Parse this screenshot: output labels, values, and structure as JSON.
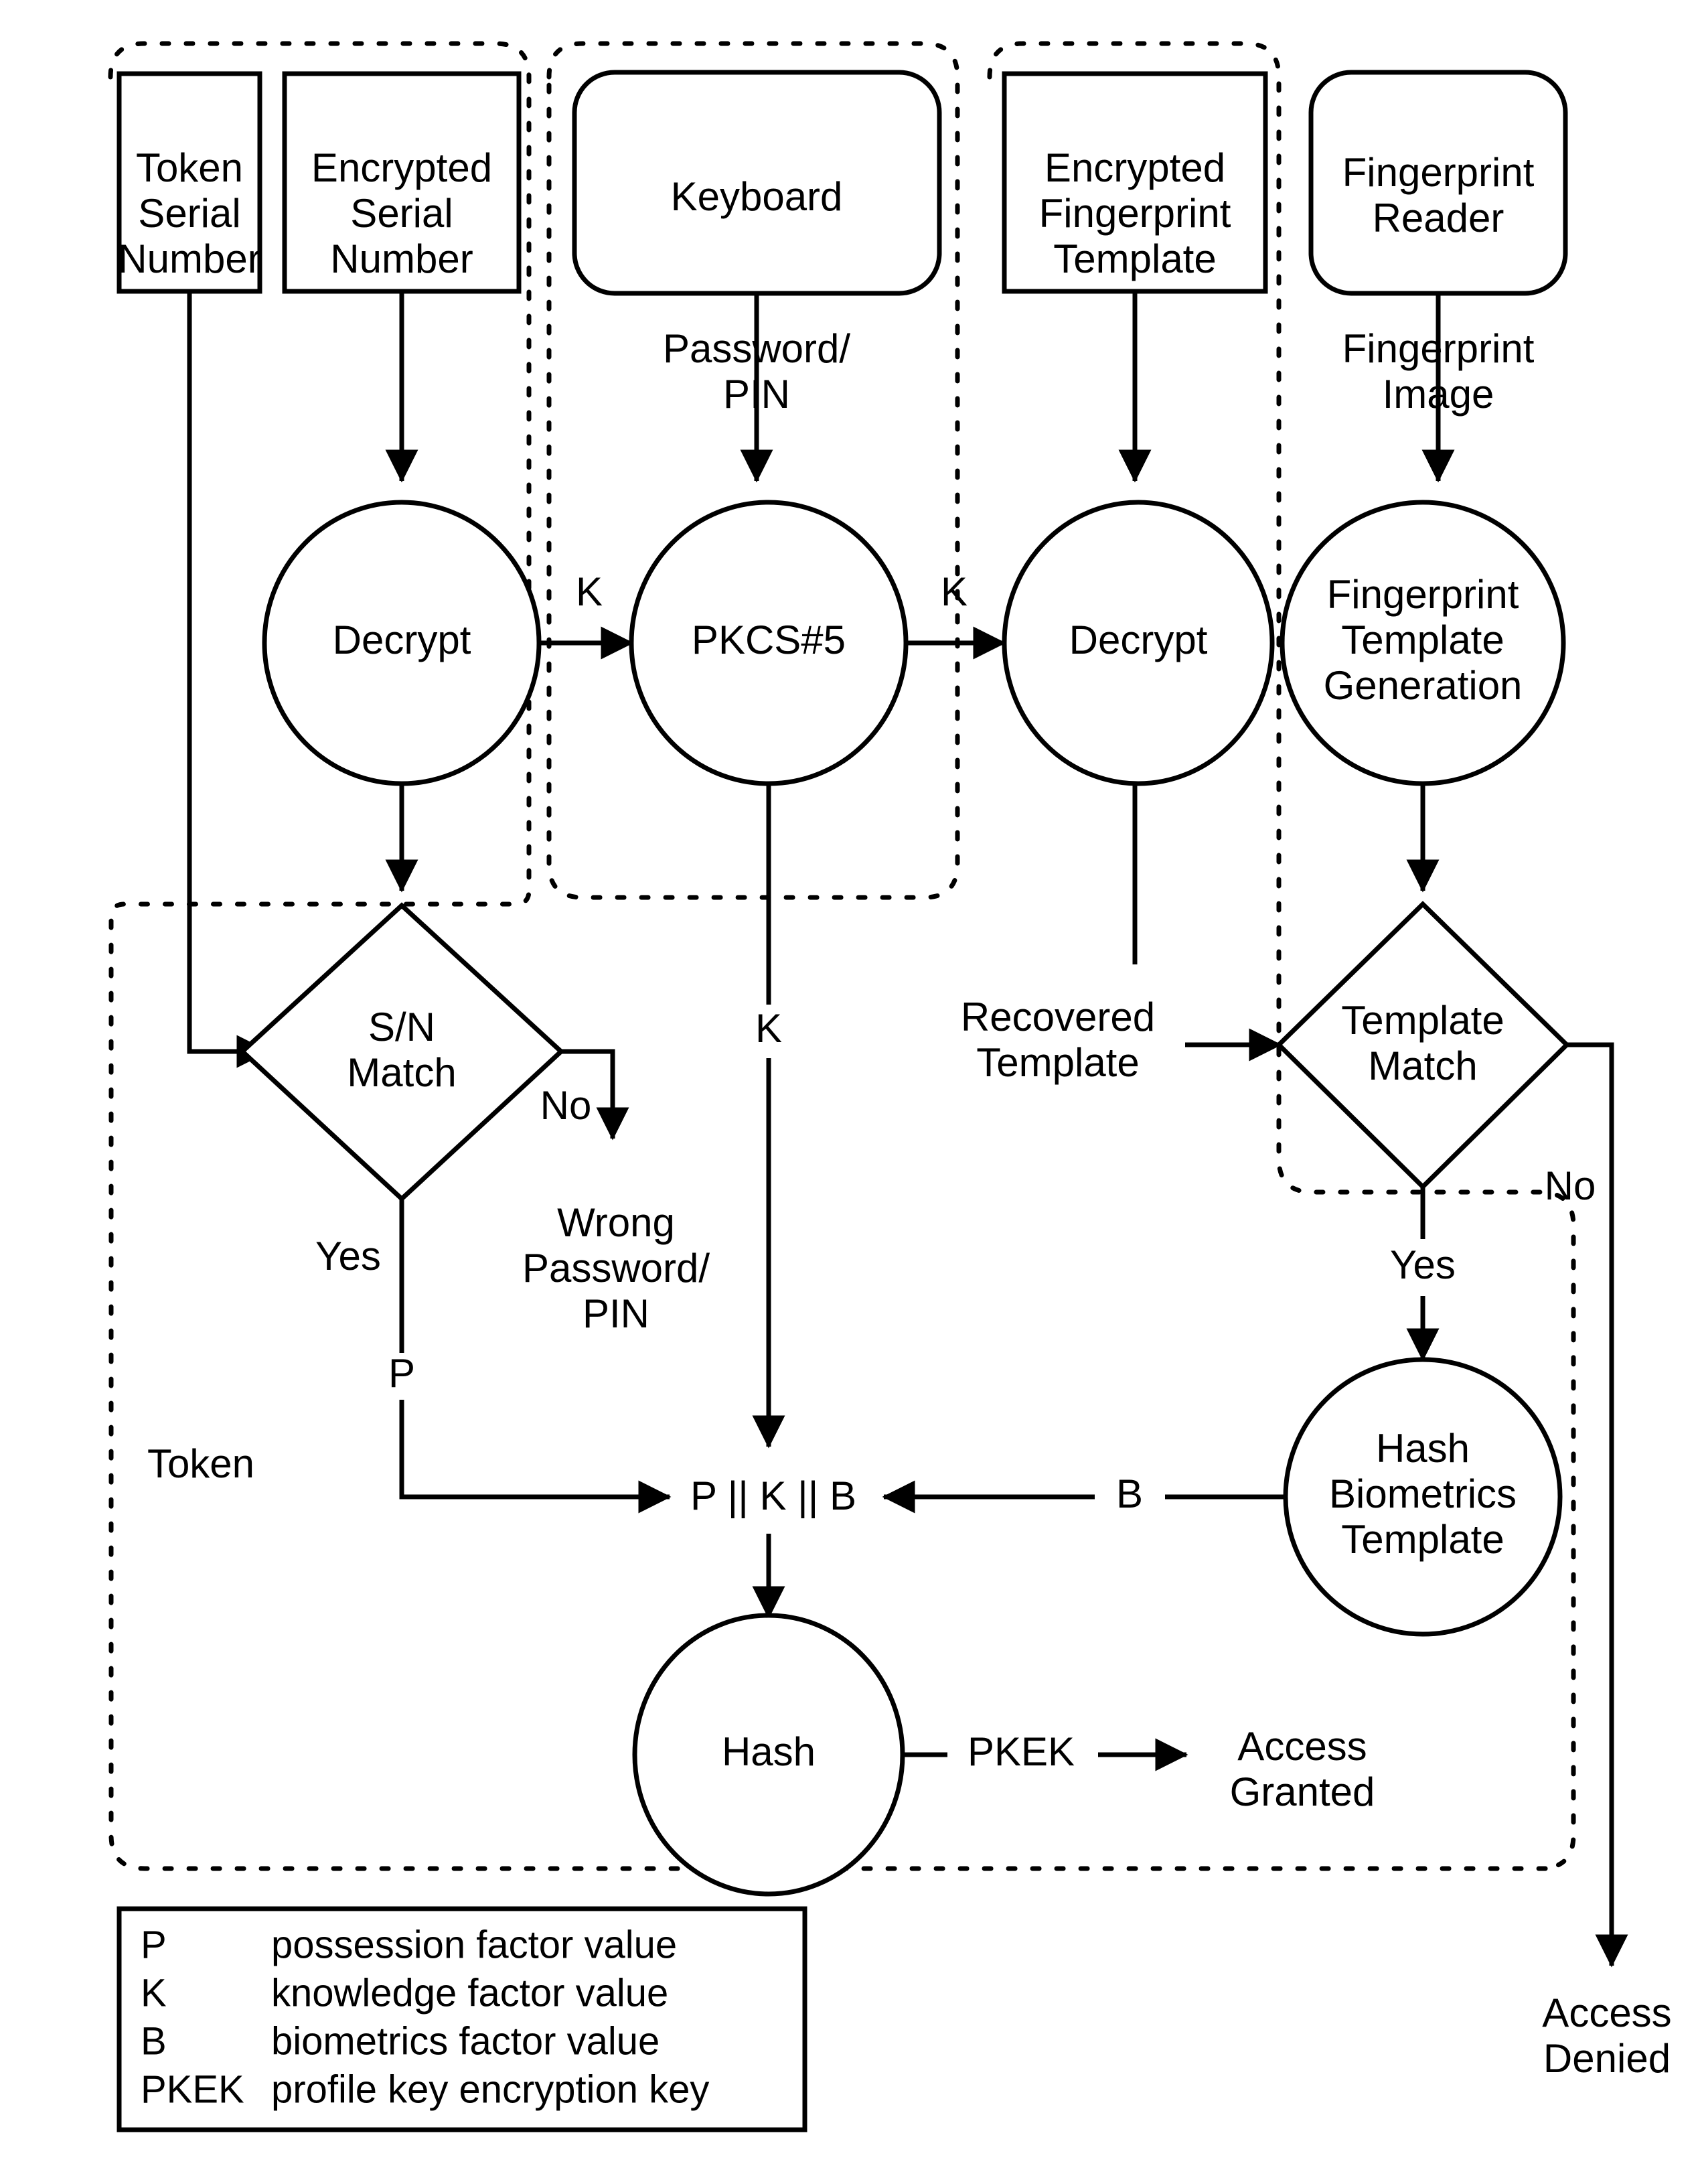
{
  "diagram": {
    "title": "Three-factor authentication flow",
    "colors": {
      "ink": "#000000",
      "paper": "#ffffff"
    },
    "nodes": {
      "token_serial_number": "Token\nSerial\nNumber",
      "token_serial_number_lines": [
        "Token",
        "Serial",
        "Number"
      ],
      "encrypted_serial_number_lines": [
        "Encrypted",
        "Serial",
        "Number"
      ],
      "keyboard": "Keyboard",
      "encrypted_fingerprint_template_lines": [
        "Encrypted",
        "Fingerprint",
        "Template"
      ],
      "fingerprint_reader_lines": [
        "Fingerprint",
        "Reader"
      ],
      "decrypt_left": "Decrypt",
      "pkcs5": "PKCS#5",
      "decrypt_right": "Decrypt",
      "fingerprint_template_generation_lines": [
        "Fingerprint",
        "Template",
        "Generation"
      ],
      "sn_match_lines": [
        "S/N",
        "Match"
      ],
      "template_match_lines": [
        "Template",
        "Match"
      ],
      "hash_biometrics_template_lines": [
        "Hash",
        "Biometrics",
        "Template"
      ],
      "hash": "Hash",
      "concat": "P || K || B"
    },
    "edge_labels": {
      "password_pin_lines": [
        "Password/",
        "PIN"
      ],
      "fingerprint_image_lines": [
        "Fingerprint",
        "Image"
      ],
      "k_decrypt_to_pkcs5": "K",
      "k_pkcs5_to_decrypt": "K",
      "k_down": "K",
      "b_right": "B",
      "pkek": "PKEK",
      "recovered_template_lines": [
        "Recovered",
        "Template"
      ],
      "yes_left": "Yes",
      "no_left": "No",
      "yes_right": "Yes",
      "no_right": "No",
      "p_left": "P",
      "token_group": "Token"
    },
    "terminals": {
      "wrong_password_pin_lines": [
        "Wrong",
        "Password/",
        "PIN"
      ],
      "access_granted_lines": [
        "Access",
        "Granted"
      ],
      "access_denied_lines": [
        "Access",
        "Denied"
      ]
    },
    "legend": {
      "rows": [
        {
          "symbol": "P",
          "description": "possession factor value"
        },
        {
          "symbol": "K",
          "description": "knowledge factor value"
        },
        {
          "symbol": "B",
          "description": "biometrics factor value"
        },
        {
          "symbol": "PKEK",
          "description": "profile key encryption key"
        }
      ]
    }
  }
}
